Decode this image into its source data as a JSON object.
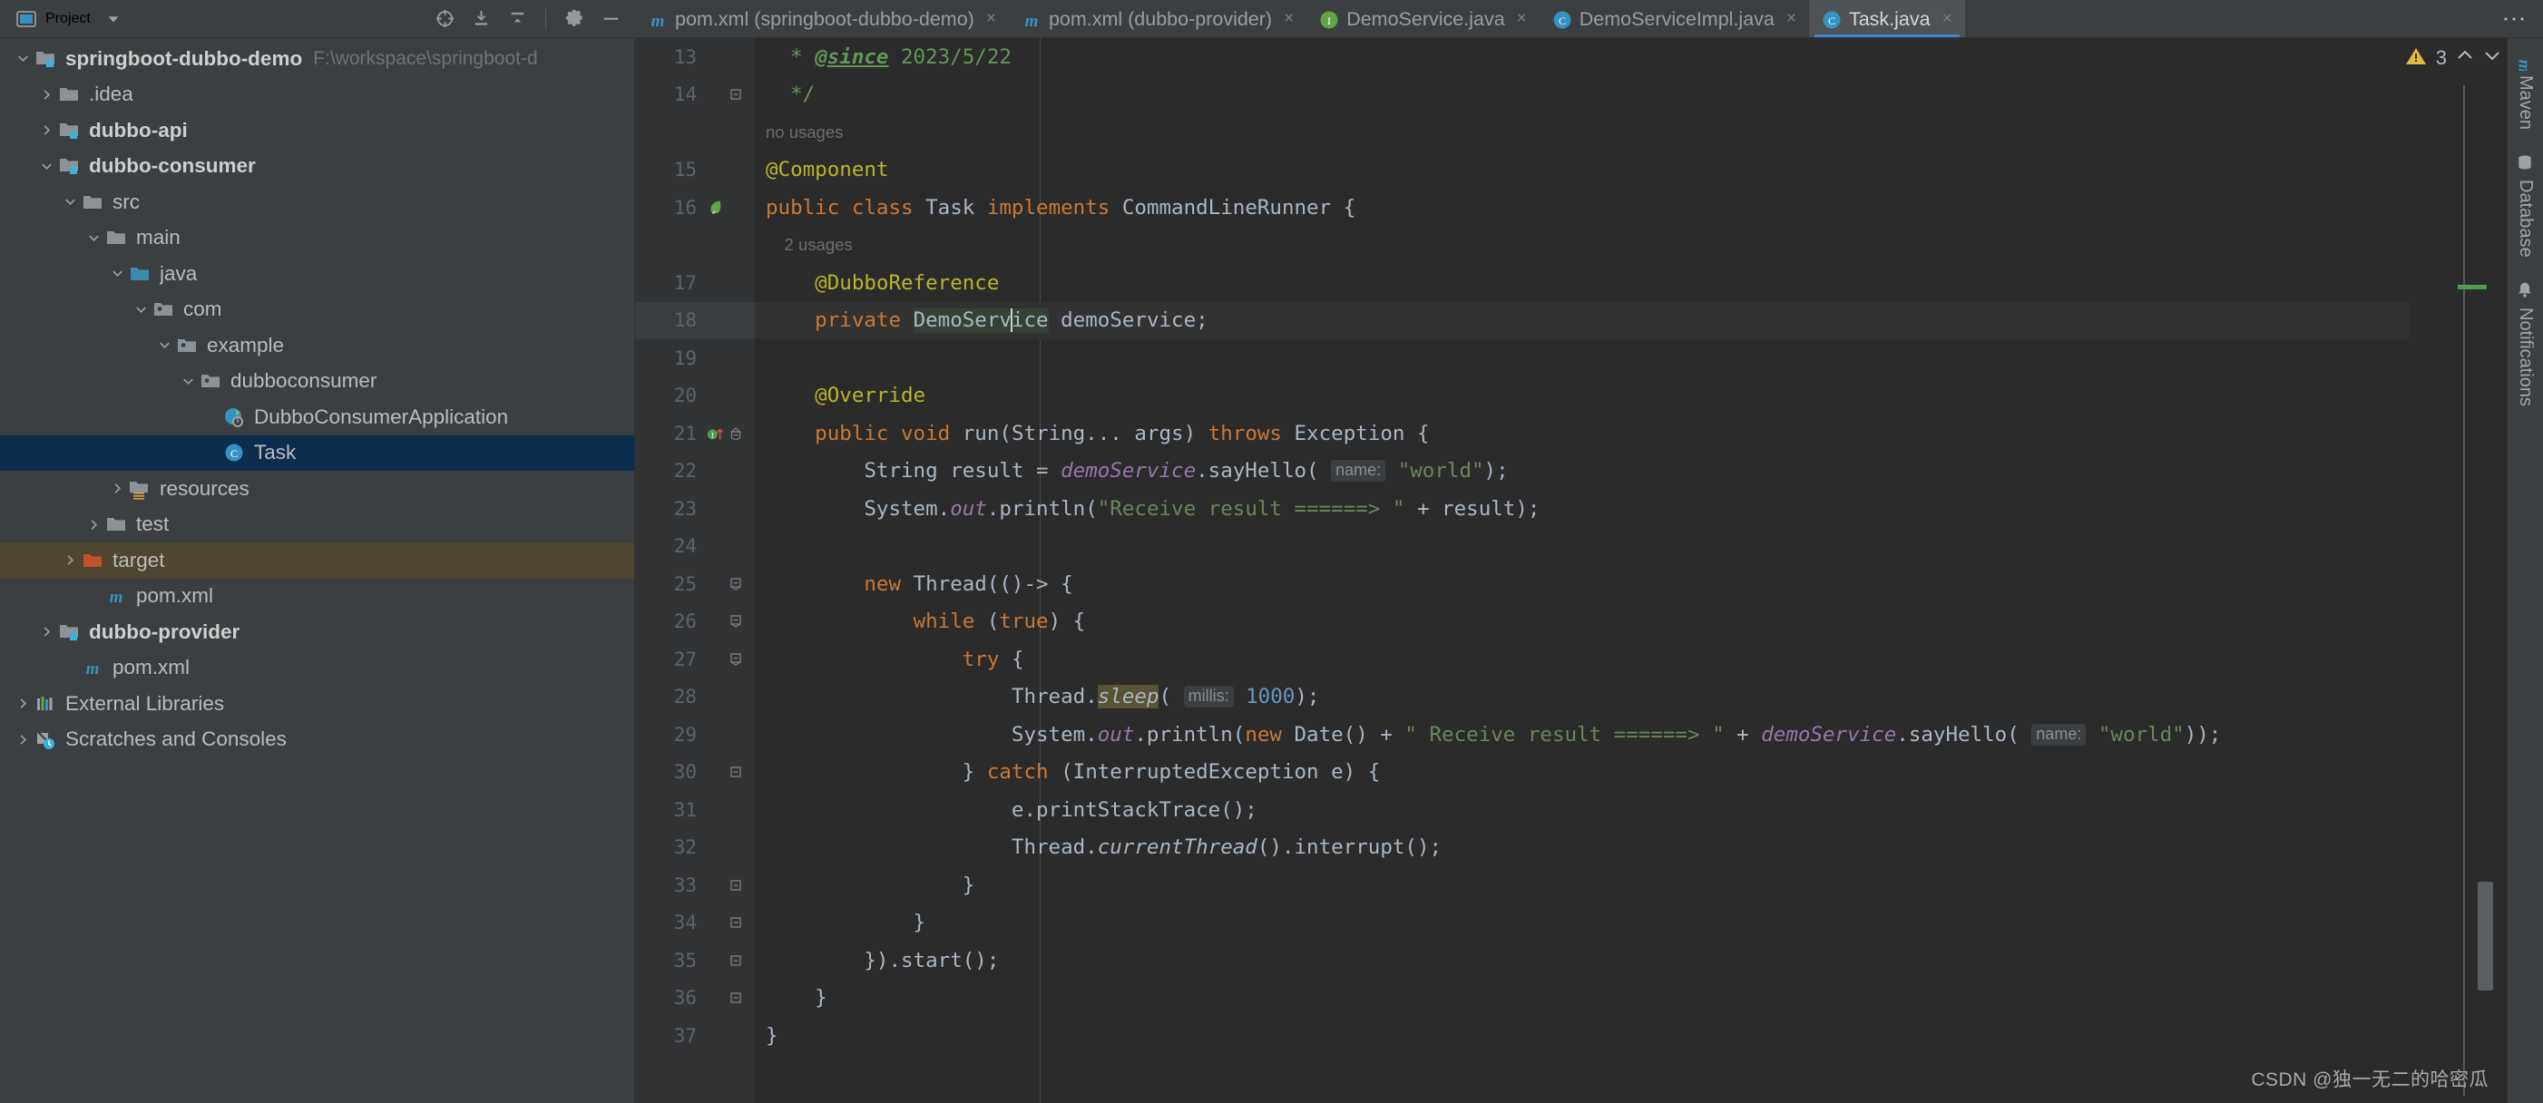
{
  "project_panel": {
    "title": "Project",
    "dropdown_icon": "chevron-down-icon",
    "toolbar": [
      {
        "name": "locate-icon",
        "label": "Select Opened File"
      },
      {
        "name": "expand-all-icon",
        "label": "Expand All"
      },
      {
        "name": "collapse-all-icon",
        "label": "Collapse All"
      },
      {
        "name": "gear-icon",
        "label": "Options"
      },
      {
        "name": "minimize-icon",
        "label": "Hide"
      }
    ]
  },
  "tree": [
    {
      "label": "springboot-dubbo-demo",
      "path": "F:\\workspace\\springboot-d",
      "icon": "module-folder-icon",
      "arrow": "expanded",
      "indent": 0,
      "bold": true,
      "state": "normal"
    },
    {
      "label": ".idea",
      "path": "",
      "icon": "folder-icon",
      "arrow": "collapsed",
      "indent": 1,
      "bold": false,
      "state": "normal"
    },
    {
      "label": "dubbo-api",
      "path": "",
      "icon": "module-folder-icon",
      "arrow": "collapsed",
      "indent": 1,
      "bold": true,
      "state": "normal"
    },
    {
      "label": "dubbo-consumer",
      "path": "",
      "icon": "module-folder-icon",
      "arrow": "expanded",
      "indent": 1,
      "bold": true,
      "state": "normal"
    },
    {
      "label": "src",
      "path": "",
      "icon": "folder-icon",
      "arrow": "expanded",
      "indent": 2,
      "bold": false,
      "state": "normal"
    },
    {
      "label": "main",
      "path": "",
      "icon": "folder-icon",
      "arrow": "expanded",
      "indent": 3,
      "bold": false,
      "state": "normal"
    },
    {
      "label": "java",
      "path": "",
      "icon": "source-folder-icon",
      "arrow": "expanded",
      "indent": 4,
      "bold": false,
      "state": "normal"
    },
    {
      "label": "com",
      "path": "",
      "icon": "package-icon",
      "arrow": "expanded",
      "indent": 5,
      "bold": false,
      "state": "normal"
    },
    {
      "label": "example",
      "path": "",
      "icon": "package-icon",
      "arrow": "expanded",
      "indent": 6,
      "bold": false,
      "state": "normal"
    },
    {
      "label": "dubboconsumer",
      "path": "",
      "icon": "package-icon",
      "arrow": "expanded",
      "indent": 7,
      "bold": false,
      "state": "normal"
    },
    {
      "label": "DubboConsumerApplication",
      "path": "",
      "icon": "spring-class-icon",
      "arrow": "none",
      "indent": 8,
      "bold": false,
      "state": "normal"
    },
    {
      "label": "Task",
      "path": "",
      "icon": "java-class-icon",
      "arrow": "none",
      "indent": 8,
      "bold": false,
      "state": "selected"
    },
    {
      "label": "resources",
      "path": "",
      "icon": "resources-folder-icon",
      "arrow": "collapsed",
      "indent": 4,
      "bold": false,
      "state": "normal"
    },
    {
      "label": "test",
      "path": "",
      "icon": "folder-icon",
      "arrow": "collapsed",
      "indent": 3,
      "bold": false,
      "state": "normal"
    },
    {
      "label": "target",
      "path": "",
      "icon": "excluded-folder-icon",
      "arrow": "collapsed",
      "indent": 2,
      "bold": false,
      "state": "excluded"
    },
    {
      "label": "pom.xml",
      "path": "",
      "icon": "maven-icon",
      "arrow": "none",
      "indent": 3,
      "bold": false,
      "state": "normal"
    },
    {
      "label": "dubbo-provider",
      "path": "",
      "icon": "module-folder-icon",
      "arrow": "collapsed",
      "indent": 1,
      "bold": true,
      "state": "normal"
    },
    {
      "label": "pom.xml",
      "path": "",
      "icon": "maven-icon",
      "arrow": "none",
      "indent": 2,
      "bold": false,
      "state": "normal"
    },
    {
      "label": "External Libraries",
      "path": "",
      "icon": "libraries-icon",
      "arrow": "collapsed",
      "indent": 0,
      "bold": false,
      "state": "normal"
    },
    {
      "label": "Scratches and Consoles",
      "path": "",
      "icon": "scratches-icon",
      "arrow": "collapsed",
      "indent": 0,
      "bold": false,
      "state": "normal"
    }
  ],
  "tabs": [
    {
      "label": "pom.xml (springboot-dubbo-demo)",
      "icon": "maven-icon",
      "active": false,
      "close": "×"
    },
    {
      "label": "pom.xml (dubbo-provider)",
      "icon": "maven-icon",
      "active": false,
      "close": "×"
    },
    {
      "label": "DemoService.java",
      "icon": "java-interface-icon",
      "active": false,
      "close": "×"
    },
    {
      "label": "DemoServiceImpl.java",
      "icon": "java-class-icon",
      "active": false,
      "close": "×"
    },
    {
      "label": "Task.java",
      "icon": "java-class-icon",
      "active": true,
      "close": "×"
    }
  ],
  "tabbar_overflow_icon": "kebab-menu-icon",
  "editor": {
    "first_line": 13,
    "lines": [
      {
        "num": "13",
        "gutter_mark": "",
        "fold": "",
        "current": false,
        "tokens": [
          {
            "t": "  * ",
            "c": "cmt"
          },
          {
            "t": "@since",
            "c": "cmtu"
          },
          {
            "t": " 2023/5/22",
            "c": "cmt"
          }
        ]
      },
      {
        "num": "14",
        "gutter_mark": "",
        "fold": "fold-end",
        "current": false,
        "tokens": [
          {
            "t": "  */",
            "c": "cmt"
          }
        ]
      },
      {
        "num": "",
        "gutter_mark": "",
        "fold": "",
        "current": false,
        "hint": "no usages",
        "tokens": []
      },
      {
        "num": "15",
        "gutter_mark": "",
        "fold": "",
        "current": false,
        "tokens": [
          {
            "t": "@Component",
            "c": "ann"
          }
        ]
      },
      {
        "num": "16",
        "gutter_mark": "spring-bean-icon",
        "fold": "",
        "current": false,
        "tokens": [
          {
            "t": "public class ",
            "c": "kw"
          },
          {
            "t": "Task ",
            "c": "plain"
          },
          {
            "t": "implements ",
            "c": "kw"
          },
          {
            "t": "CommandLineRunner {",
            "c": "cls"
          }
        ]
      },
      {
        "num": "",
        "gutter_mark": "",
        "fold": "",
        "current": false,
        "hint": "    2 usages",
        "tokens": []
      },
      {
        "num": "17",
        "gutter_mark": "",
        "fold": "",
        "current": false,
        "tokens": [
          {
            "t": "    @DubboReference",
            "c": "ann"
          }
        ]
      },
      {
        "num": "18",
        "gutter_mark": "",
        "fold": "",
        "current": true,
        "tokens": [
          {
            "t": "    private ",
            "c": "kw"
          },
          {
            "t": "DemoService",
            "c": "cls",
            "hl": "sel-ident",
            "caret_after": 8
          },
          {
            "t": " demoService;",
            "c": "plain"
          }
        ]
      },
      {
        "num": "19",
        "gutter_mark": "",
        "fold": "",
        "current": false,
        "tokens": []
      },
      {
        "num": "20",
        "gutter_mark": "",
        "fold": "",
        "current": false,
        "tokens": [
          {
            "t": "    @Override",
            "c": "ann"
          }
        ]
      },
      {
        "num": "21",
        "gutter_mark": "override-method-icon",
        "fold": "fold-start",
        "current": false,
        "tokens": [
          {
            "t": "    public void ",
            "c": "kw"
          },
          {
            "t": "run",
            "c": "plain"
          },
          {
            "t": "(",
            "c": "plain"
          },
          {
            "t": "String",
            "c": "cls"
          },
          {
            "t": "... args) ",
            "c": "plain"
          },
          {
            "t": "throws ",
            "c": "kw"
          },
          {
            "t": "Exception {",
            "c": "cls"
          }
        ]
      },
      {
        "num": "22",
        "gutter_mark": "",
        "fold": "",
        "current": false,
        "tokens": [
          {
            "t": "        String result = ",
            "c": "plain"
          },
          {
            "t": "demoService",
            "c": "fld"
          },
          {
            "t": ".sayHello( ",
            "c": "plain"
          },
          {
            "t": "name:",
            "c": "param"
          },
          {
            "t": " ",
            "c": "plain"
          },
          {
            "t": "\"world\"",
            "c": "str"
          },
          {
            "t": ");",
            "c": "plain"
          }
        ]
      },
      {
        "num": "23",
        "gutter_mark": "",
        "fold": "",
        "current": false,
        "tokens": [
          {
            "t": "        System.",
            "c": "plain"
          },
          {
            "t": "out",
            "c": "fld"
          },
          {
            "t": ".println(",
            "c": "plain"
          },
          {
            "t": "\"Receive result ======> \"",
            "c": "str"
          },
          {
            "t": " + result);",
            "c": "plain"
          }
        ]
      },
      {
        "num": "24",
        "gutter_mark": "",
        "fold": "",
        "current": false,
        "tokens": []
      },
      {
        "num": "25",
        "gutter_mark": "",
        "fold": "fold-mid",
        "current": false,
        "tokens": [
          {
            "t": "        ",
            "c": "plain"
          },
          {
            "t": "new ",
            "c": "kw"
          },
          {
            "t": "Thread(()-> {",
            "c": "plain"
          }
        ]
      },
      {
        "num": "26",
        "gutter_mark": "",
        "fold": "fold-mid",
        "current": false,
        "tokens": [
          {
            "t": "            ",
            "c": "plain"
          },
          {
            "t": "while ",
            "c": "kw"
          },
          {
            "t": "(",
            "c": "plain"
          },
          {
            "t": "true",
            "c": "kw"
          },
          {
            "t": ") {",
            "c": "plain"
          }
        ]
      },
      {
        "num": "27",
        "gutter_mark": "",
        "fold": "fold-mid",
        "current": false,
        "tokens": [
          {
            "t": "                ",
            "c": "plain"
          },
          {
            "t": "try ",
            "c": "kw"
          },
          {
            "t": "{",
            "c": "plain"
          }
        ]
      },
      {
        "num": "28",
        "gutter_mark": "",
        "fold": "",
        "current": false,
        "tokens": [
          {
            "t": "                    Thread.",
            "c": "plain"
          },
          {
            "t": "sleep",
            "c": "plain",
            "hl": "sel-ident2",
            "italic": true
          },
          {
            "t": "( ",
            "c": "plain"
          },
          {
            "t": "millis:",
            "c": "param"
          },
          {
            "t": " ",
            "c": "plain"
          },
          {
            "t": "1000",
            "c": "num"
          },
          {
            "t": ");",
            "c": "plain"
          }
        ]
      },
      {
        "num": "29",
        "gutter_mark": "",
        "fold": "",
        "current": false,
        "tokens": [
          {
            "t": "                    System.",
            "c": "plain"
          },
          {
            "t": "out",
            "c": "fld"
          },
          {
            "t": ".println(",
            "c": "plain"
          },
          {
            "t": "new ",
            "c": "kw"
          },
          {
            "t": "Date() + ",
            "c": "plain"
          },
          {
            "t": "\" Receive result ======> \"",
            "c": "str"
          },
          {
            "t": " + ",
            "c": "plain"
          },
          {
            "t": "demoService",
            "c": "fld"
          },
          {
            "t": ".sayHello( ",
            "c": "plain"
          },
          {
            "t": "name:",
            "c": "param"
          },
          {
            "t": " ",
            "c": "plain"
          },
          {
            "t": "\"world\"",
            "c": "str"
          },
          {
            "t": "));",
            "c": "plain"
          }
        ]
      },
      {
        "num": "30",
        "gutter_mark": "",
        "fold": "fold-end",
        "current": false,
        "tokens": [
          {
            "t": "                } ",
            "c": "plain"
          },
          {
            "t": "catch ",
            "c": "kw"
          },
          {
            "t": "(InterruptedException e) {",
            "c": "plain"
          }
        ]
      },
      {
        "num": "31",
        "gutter_mark": "",
        "fold": "",
        "current": false,
        "tokens": [
          {
            "t": "                    e.printStackTrace();",
            "c": "plain"
          }
        ]
      },
      {
        "num": "32",
        "gutter_mark": "",
        "fold": "",
        "current": false,
        "tokens": [
          {
            "t": "                    Thread.",
            "c": "plain"
          },
          {
            "t": "currentThread",
            "c": "plain",
            "italic": true
          },
          {
            "t": "().interrupt();",
            "c": "plain"
          }
        ]
      },
      {
        "num": "33",
        "gutter_mark": "",
        "fold": "fold-end",
        "current": false,
        "tokens": [
          {
            "t": "                }",
            "c": "plain"
          }
        ]
      },
      {
        "num": "34",
        "gutter_mark": "",
        "fold": "fold-end",
        "current": false,
        "tokens": [
          {
            "t": "            }",
            "c": "plain"
          }
        ]
      },
      {
        "num": "35",
        "gutter_mark": "",
        "fold": "fold-end",
        "current": false,
        "tokens": [
          {
            "t": "        }).start();",
            "c": "plain"
          }
        ]
      },
      {
        "num": "36",
        "gutter_mark": "",
        "fold": "fold-end",
        "current": false,
        "tokens": [
          {
            "t": "    }",
            "c": "plain"
          }
        ]
      },
      {
        "num": "37",
        "gutter_mark": "",
        "fold": "",
        "current": false,
        "tokens": [
          {
            "t": "}",
            "c": "plain"
          }
        ]
      }
    ]
  },
  "inspection": {
    "icon": "warning-triangle-icon",
    "count": "3",
    "prev_icon": "chevron-up-icon",
    "next_icon": "chevron-down-icon"
  },
  "right_toolbar": [
    {
      "label": "Maven",
      "icon": "maven-icon"
    },
    {
      "label": "Database",
      "icon": "database-icon"
    },
    {
      "label": "Notifications",
      "icon": "bell-icon"
    }
  ],
  "watermark": "CSDN @独一无二的哈密瓜",
  "colors": {
    "accent": "#3d86d0",
    "selection": "#0d2d4e",
    "excluded": "#4f4632",
    "editor_bg": "#2b2b2b",
    "panel_bg": "#3c3f41",
    "warning": "#e2b93d"
  }
}
